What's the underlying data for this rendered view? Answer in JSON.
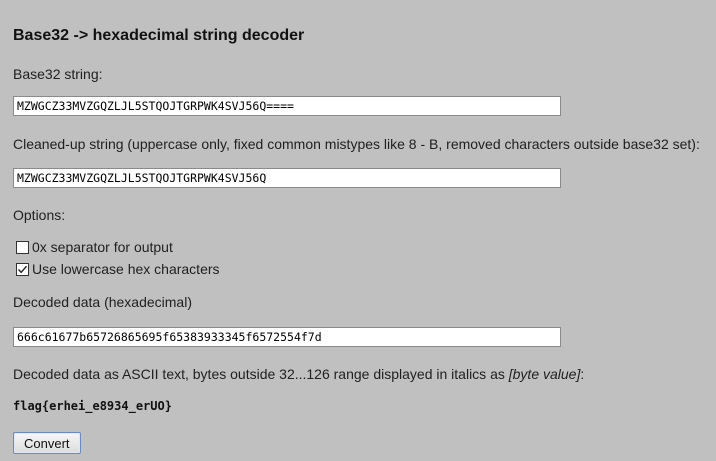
{
  "title": "Base32 -> hexadecimal string decoder",
  "base32": {
    "label": "Base32 string:",
    "value": "MZWGCZ33MVZGQZLJL5STQOJTGRPWK4SVJ56Q===="
  },
  "cleaned": {
    "label": "Cleaned-up string (uppercase only, fixed common mistypes like 8 - B, removed characters outside base32 set):",
    "value": "MZWGCZ33MVZGQZLJL5STQOJTGRPWK4SVJ56Q"
  },
  "options": {
    "label": "Options:",
    "items": [
      {
        "label": "0x separator for output",
        "checked": false
      },
      {
        "label": "Use lowercase hex characters",
        "checked": true
      }
    ]
  },
  "decoded_hex": {
    "label": "Decoded data (hexadecimal)",
    "value": "666c61677b65726865695f65383933345f6572554f7d"
  },
  "ascii": {
    "label_prefix": "Decoded data as ASCII text, bytes outside 32...126 range displayed in italics as ",
    "label_italic": "[byte value]",
    "label_suffix": ":",
    "value": "flag{erhei_e8934_erUO}"
  },
  "convert_button": "Convert"
}
